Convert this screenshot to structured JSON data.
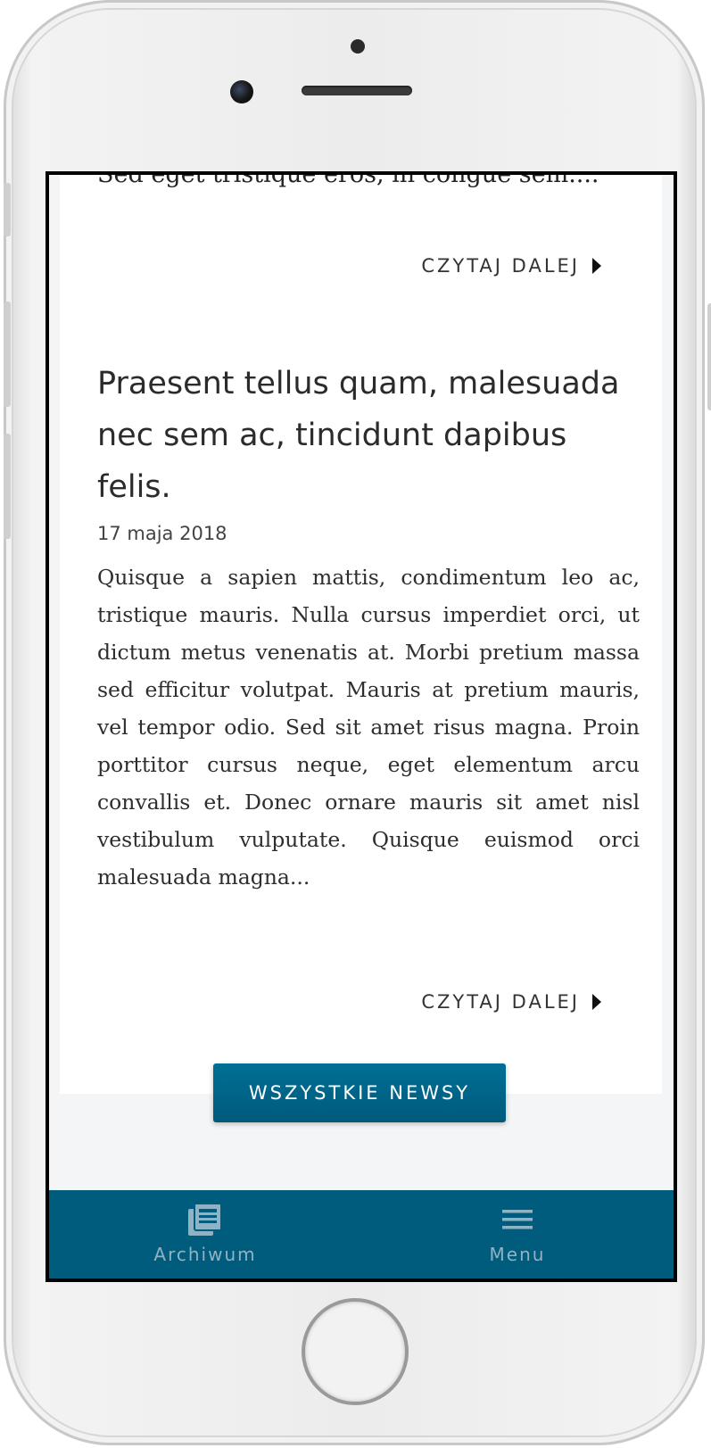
{
  "article_prev": {
    "truncated_text": "Sed eget tristique eros, in congue sem....",
    "read_more_label": "CZYTAJ DALEJ"
  },
  "article": {
    "title": "Praesent tellus quam, malesuada nec sem ac, tincidunt dapibus felis.",
    "date": "17 maja 2018",
    "body": "Quisque a sapien mattis, condimentum leo ac, tristique mauris. Nulla cursus imperdiet orci, ut dictum metus venenatis at. Morbi pretium massa sed efficitur volutpat. Mauris at pretium mauris, vel tempor odio. Sed sit amet risus magna. Proin porttitor cursus neque, eget elementum arcu convallis et. Donec ornare mauris sit amet nisl vestibulum vulputate. Quisque euismod orci malesuada magna...",
    "read_more_label": "CZYTAJ DALEJ"
  },
  "all_news_button": "WSZYSTKIE NEWSY",
  "bottom_nav": {
    "items": [
      {
        "label": "Archiwum",
        "icon": "newspaper-icon"
      },
      {
        "label": "Menu",
        "icon": "hamburger-menu-icon"
      }
    ]
  },
  "colors": {
    "brand": "#005c7d",
    "button": "#006f95",
    "nav_label": "#8fb3c4"
  }
}
